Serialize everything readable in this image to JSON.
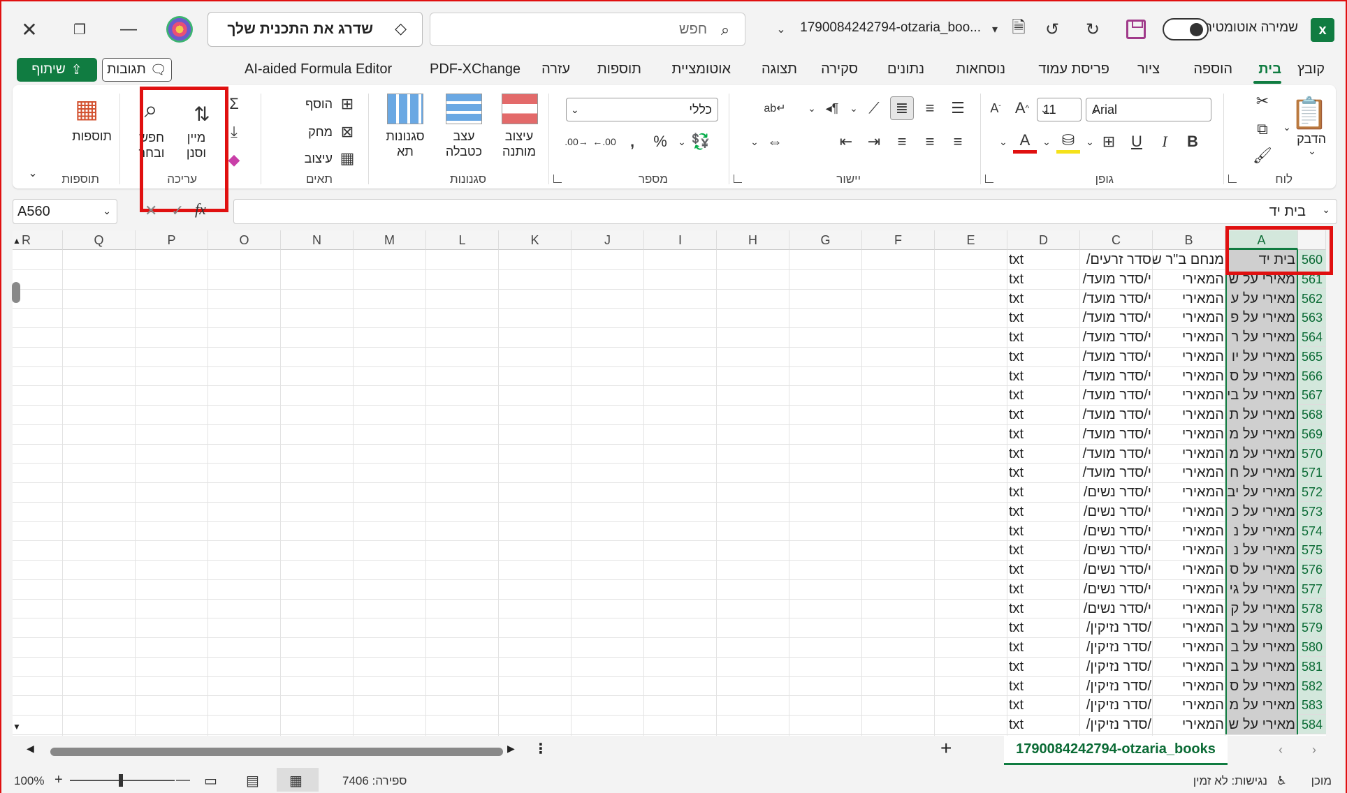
{
  "titlebar": {
    "filename": "1790084242794-otzaria_boo...",
    "autosave_label": "שמירה אוטומטית",
    "search_placeholder": "חפש",
    "upgrade_label": "שדרג את התכנית שלך"
  },
  "menu": {
    "tabs": [
      "קובץ",
      "בית",
      "הוספה",
      "ציור",
      "פריסת עמוד",
      "נוסחאות",
      "נתונים",
      "סקירה",
      "תצוגה",
      "אוטומציית",
      "תוספות",
      "עזרה",
      "PDF-XChange",
      "AI-aided Formula Editor"
    ],
    "active_tab": "בית",
    "comments_label": "תגובות",
    "share_label": "שיתוף"
  },
  "ribbon": {
    "clipboard": {
      "label": "לוח",
      "paste": "הדבק"
    },
    "font": {
      "label": "גופן",
      "font_name": "Arial",
      "font_size": "11"
    },
    "alignment": {
      "label": "יישור"
    },
    "number": {
      "label": "מספר",
      "format": "כללי"
    },
    "styles": {
      "label": "סגנונות",
      "conditional": [
        "עיצוב",
        "מותנה"
      ],
      "format_table": [
        "עצב",
        "כטבלה"
      ],
      "cell_styles": [
        "סגנונות",
        "תא"
      ]
    },
    "cells": {
      "label": "תאים",
      "insert": "הוסף",
      "delete": "מחק",
      "format": "עיצוב"
    },
    "editing": {
      "label": "עריכה",
      "sort_filter": [
        "מיין",
        "וסנן"
      ],
      "find_select": [
        "חפש",
        "ובחר"
      ]
    },
    "addins": {
      "label": "תוספות",
      "addins_btn": "תוספות"
    }
  },
  "formula_bar": {
    "name_box": "A560",
    "fx": "fx",
    "content": "בית יד"
  },
  "grid": {
    "columns": [
      "A",
      "B",
      "C",
      "D",
      "E",
      "F",
      "G",
      "H",
      "I",
      "J",
      "K",
      "L",
      "M",
      "N",
      "O",
      "P",
      "Q",
      "R"
    ],
    "rows": [
      {
        "n": "560",
        "a": "בית יד",
        "b": "מנחם ב\"ר ש",
        "c": "סדר זרעים/",
        "d": "txt"
      },
      {
        "n": "561",
        "a": "מאירי על ש",
        "b": "המאירי",
        "c": "י/סדר מועד/",
        "d": "txt"
      },
      {
        "n": "562",
        "a": "מאירי על ע",
        "b": "המאירי",
        "c": "י/סדר מועד/",
        "d": "txt"
      },
      {
        "n": "563",
        "a": "מאירי על פ",
        "b": "המאירי",
        "c": "י/סדר מועד/",
        "d": "txt"
      },
      {
        "n": "564",
        "a": "מאירי על ר",
        "b": "המאירי",
        "c": "י/סדר מועד/",
        "d": "txt"
      },
      {
        "n": "565",
        "a": "מאירי על יו",
        "b": "המאירי",
        "c": "י/סדר מועד/",
        "d": "txt"
      },
      {
        "n": "566",
        "a": "מאירי על ס",
        "b": "המאירי",
        "c": "י/סדר מועד/",
        "d": "txt"
      },
      {
        "n": "567",
        "a": "מאירי על בי",
        "b": "המאירי",
        "c": "י/סדר מועד/",
        "d": "txt"
      },
      {
        "n": "568",
        "a": "מאירי על ת",
        "b": "המאירי",
        "c": "י/סדר מועד/",
        "d": "txt"
      },
      {
        "n": "569",
        "a": "מאירי על מ",
        "b": "המאירי",
        "c": "י/סדר מועד/",
        "d": "txt"
      },
      {
        "n": "570",
        "a": "מאירי על מ",
        "b": "המאירי",
        "c": "י/סדר מועד/",
        "d": "txt"
      },
      {
        "n": "571",
        "a": "מאירי על ח",
        "b": "המאירי",
        "c": "י/סדר מועד/",
        "d": "txt"
      },
      {
        "n": "572",
        "a": "מאירי על יב",
        "b": "המאירי",
        "c": "י/סדר נשים/",
        "d": "txt"
      },
      {
        "n": "573",
        "a": "מאירי על כ",
        "b": "המאירי",
        "c": "י/סדר נשים/",
        "d": "txt"
      },
      {
        "n": "574",
        "a": "מאירי על נ",
        "b": "המאירי",
        "c": "י/סדר נשים/",
        "d": "txt"
      },
      {
        "n": "575",
        "a": "מאירי על נ",
        "b": "המאירי",
        "c": "י/סדר נשים/",
        "d": "txt"
      },
      {
        "n": "576",
        "a": "מאירי על ס",
        "b": "המאירי",
        "c": "י/סדר נשים/",
        "d": "txt"
      },
      {
        "n": "577",
        "a": "מאירי על גי",
        "b": "המאירי",
        "c": "י/סדר נשים/",
        "d": "txt"
      },
      {
        "n": "578",
        "a": "מאירי על ק",
        "b": "המאירי",
        "c": "י/סדר נשים/",
        "d": "txt"
      },
      {
        "n": "579",
        "a": "מאירי על ב",
        "b": "המאירי",
        "c": "/סדר נזיקין/",
        "d": "txt"
      },
      {
        "n": "580",
        "a": "מאירי על ב",
        "b": "המאירי",
        "c": "/סדר נזיקין/",
        "d": "txt"
      },
      {
        "n": "581",
        "a": "מאירי על ב",
        "b": "המאירי",
        "c": "/סדר נזיקין/",
        "d": "txt"
      },
      {
        "n": "582",
        "a": "מאירי על ס",
        "b": "המאירי",
        "c": "/סדר נזיקין/",
        "d": "txt"
      },
      {
        "n": "583",
        "a": "מאירי על מ",
        "b": "המאירי",
        "c": "/סדר נזיקין/",
        "d": "txt"
      },
      {
        "n": "584",
        "a": "מאירי על ש",
        "b": "המאירי",
        "c": "/סדר נזיקין/",
        "d": "txt"
      }
    ]
  },
  "sheets": {
    "active": "1790084242794-otzaria_books",
    "add": "+"
  },
  "status": {
    "ready": "מוכן",
    "accessibility": "נגישות: לא זמין",
    "count": "ספירה: 7406",
    "zoom": "100%"
  },
  "colors": {
    "accent": "#107c41",
    "highlight": "#e01010"
  }
}
